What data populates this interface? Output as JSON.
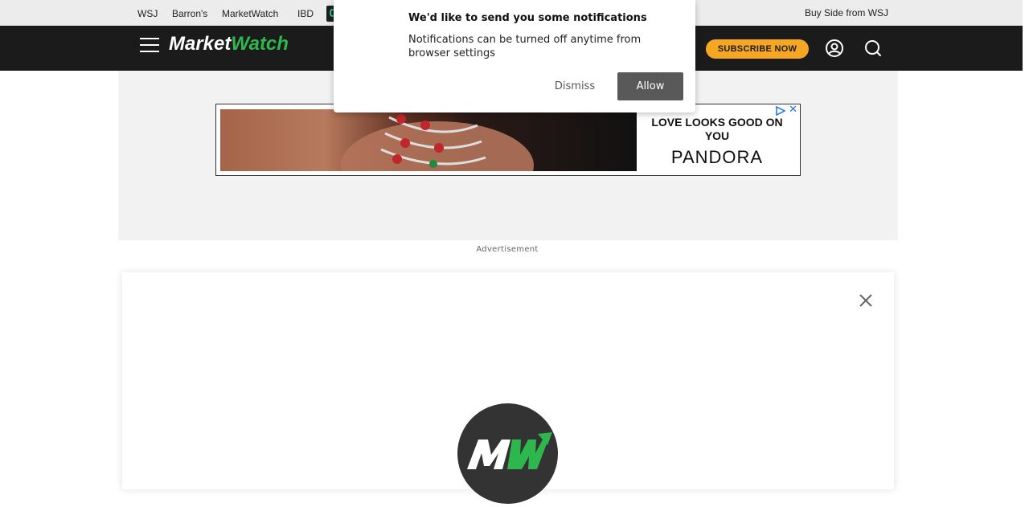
{
  "network_bar": {
    "links": [
      "WSJ",
      "Barron's",
      "MarketWatch",
      "IBD"
    ],
    "buy_side": "Buy Side from WSJ"
  },
  "header": {
    "logo_market": "Market",
    "logo_watch": "Watch",
    "subscribe_label": "SUBSCRIBE NOW",
    "icons": [
      "menu-icon",
      "user-icon",
      "search-icon"
    ]
  },
  "ad": {
    "headline": "LOVE LOOKS GOOD ON YOU",
    "brand": "PANDORA",
    "label": "Advertisement"
  },
  "notification": {
    "title": "We'd like to send you some notifications",
    "body": "Notifications can be turned off anytime from browser settings",
    "dismiss_label": "Dismiss",
    "allow_label": "Allow"
  },
  "colors": {
    "header_bg": "#1b1b1b",
    "brand_green": "#2eb74d",
    "subscribe_bg": "#f5a623",
    "allow_bg": "#595959"
  }
}
